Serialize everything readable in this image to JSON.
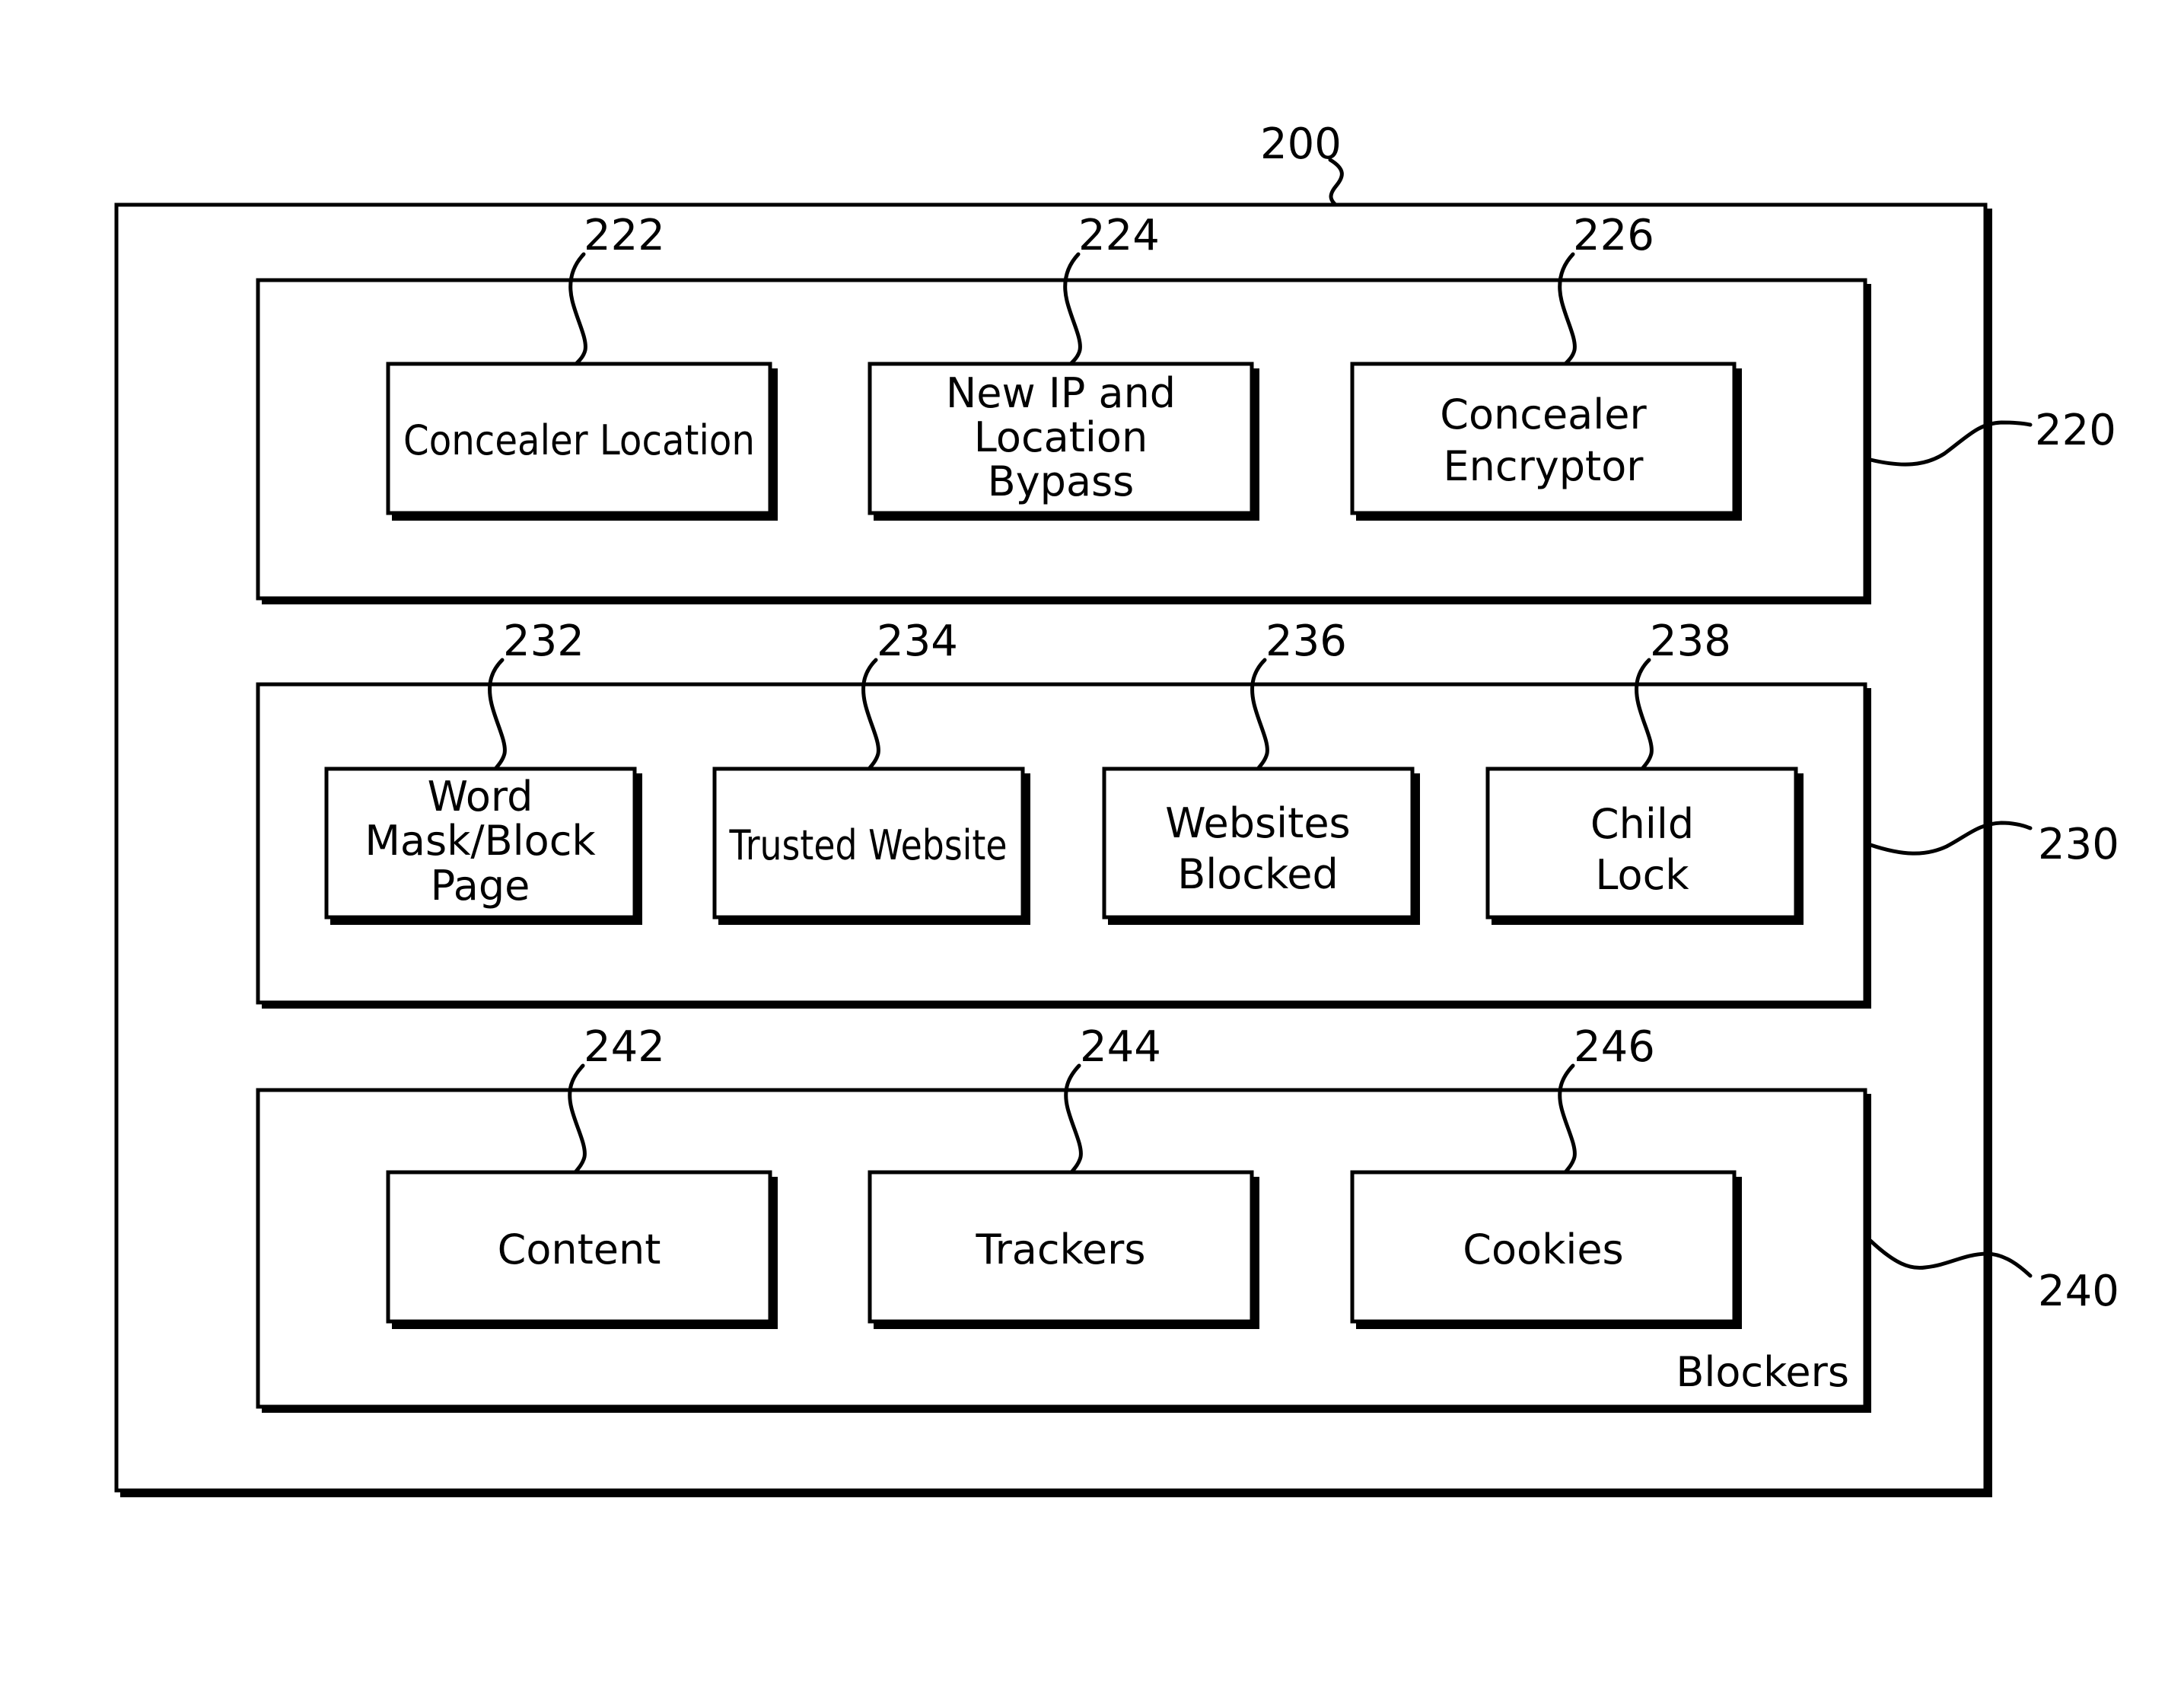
{
  "figure": {
    "system": {
      "ref": "200"
    },
    "panels": [
      {
        "ref": "220",
        "caption": "",
        "modules": [
          {
            "ref": "222",
            "lines": [
              "Concealer Location"
            ]
          },
          {
            "ref": "224",
            "lines": [
              "New IP and",
              "Location",
              "Bypass"
            ]
          },
          {
            "ref": "226",
            "lines": [
              "Concealer",
              "Encryptor"
            ]
          }
        ]
      },
      {
        "ref": "230",
        "caption": "",
        "modules": [
          {
            "ref": "232",
            "lines": [
              "Word",
              "Mask/Block",
              "Page"
            ]
          },
          {
            "ref": "234",
            "lines": [
              "Trusted Website"
            ]
          },
          {
            "ref": "236",
            "lines": [
              "Websites",
              "Blocked"
            ]
          },
          {
            "ref": "238",
            "lines": [
              "Child",
              "Lock"
            ]
          }
        ]
      },
      {
        "ref": "240",
        "caption": "Blockers",
        "modules": [
          {
            "ref": "242",
            "lines": [
              "Content"
            ]
          },
          {
            "ref": "244",
            "lines": [
              "Trackers"
            ]
          },
          {
            "ref": "246",
            "lines": [
              "Cookies"
            ]
          }
        ]
      }
    ]
  }
}
